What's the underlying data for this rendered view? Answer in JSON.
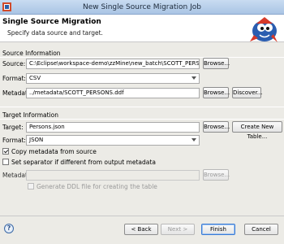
{
  "window": {
    "title": "New Single Source Migration Job"
  },
  "banner": {
    "title": "Single Source Migration",
    "subtitle": "Specify data source and target."
  },
  "source": {
    "section_label": "Source Information",
    "source_label": "Source:",
    "source_value": "C:\\Eclipse\\workspace-demo\\zzMine\\new_batch\\SCOTT_PERSONS.csv",
    "browse_label": "Browse...",
    "format_label": "Format:",
    "format_value": "CSV",
    "metadata_label": "Metadata:",
    "metadata_value": "../metadata/SCOTT_PERSONS.ddf",
    "metadata_browse_label": "Browse...",
    "discover_label": "Discover..."
  },
  "target": {
    "section_label": "Target Information",
    "target_label": "Target:",
    "target_value": "Persons.json",
    "browse_label": "Browse...",
    "create_label": "Create New Table...",
    "format_label": "Format:",
    "format_value": "JSON",
    "copy_metadata_label": "Copy metadata from source",
    "copy_metadata_checked": true,
    "separator_label": "Set separator if different from output metadata",
    "separator_checked": false,
    "metadata_label": "Metadata:",
    "metadata_value": "",
    "metadata_browse_label": "Browse...",
    "ddl_label": "Generate DDL file for creating the table",
    "ddl_checked": false
  },
  "footer": {
    "help_symbol": "?",
    "back_label": "< Back",
    "next_label": "Next >",
    "finish_label": "Finish",
    "cancel_label": "Cancel"
  }
}
